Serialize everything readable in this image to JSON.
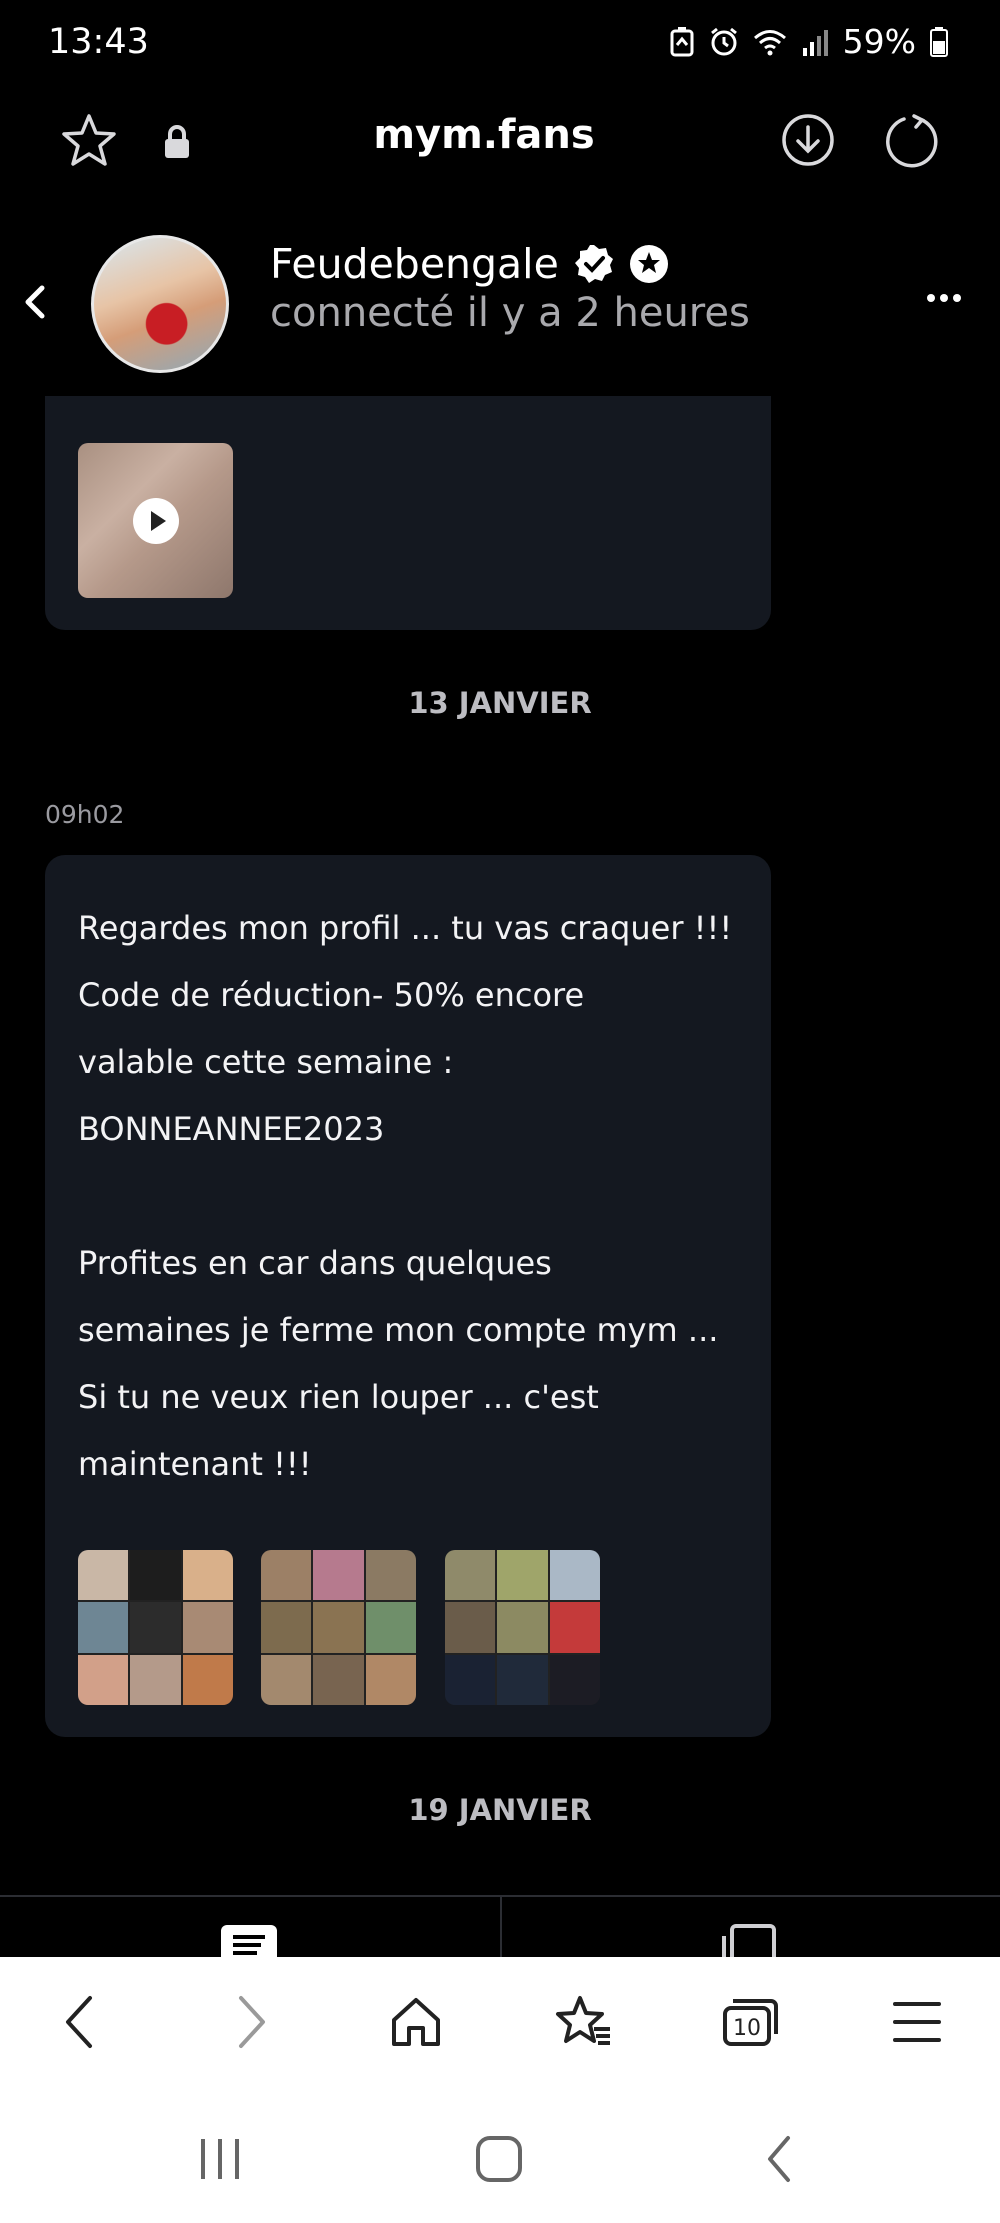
{
  "status_bar": {
    "time": "13:43",
    "battery": "59%"
  },
  "browser": {
    "url_title": "mym.fans",
    "tab_count": "10"
  },
  "chat": {
    "contact_name": "Feudebengale",
    "last_seen": "connecté il y a 2 heures",
    "date_separator_1": "13 JANVIER",
    "message_time": "09h02",
    "message_text": "Regardes mon profil ... tu vas craquer !!!\nCode de réduction- 50% encore\nvalable cette semaine :\nBONNEANNEE2023\n\nProfites en car dans quelques\nsemaines je ferme mon compte mym ...\nSi tu ne veux rien louper ... c'est\nmaintenant !!!",
    "date_separator_2": "19 JANVIER"
  },
  "colors": {
    "background": "#000000",
    "bubble": "#141820",
    "muted": "#a9a9ad",
    "nav_bg": "#ffffff"
  },
  "icons": [
    "favorite-star-icon",
    "lock-icon",
    "download-icon",
    "reload-icon",
    "back-chevron-icon",
    "verified-badge-icon",
    "star-badge-icon",
    "more-dots-icon",
    "play-icon",
    "nav-back-icon",
    "nav-forward-icon",
    "home-icon",
    "bookmarks-icon",
    "tabs-icon",
    "menu-icon",
    "recent-apps-icon",
    "home-button-icon",
    "system-back-icon"
  ]
}
